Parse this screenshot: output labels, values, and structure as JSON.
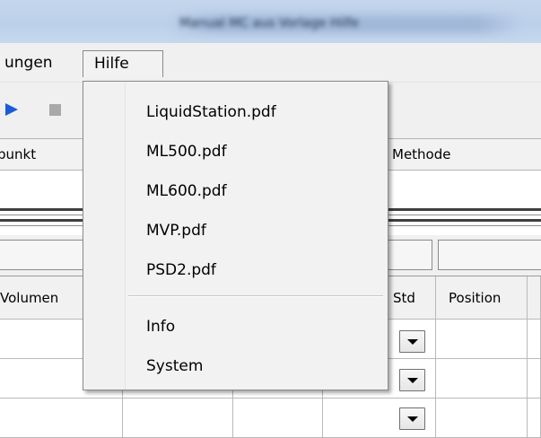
{
  "window": {
    "title": "Manual MC aus Vorlage Hilfe"
  },
  "menubar": {
    "items": [
      {
        "label": "ungen"
      },
      {
        "label": "Hilfe"
      }
    ]
  },
  "toolbar": {
    "play_icon": "play-icon",
    "stop_icon": "stop-icon",
    "accent_color": "#1a5bd8"
  },
  "header_row": {
    "col_left": "punkt",
    "col_methode": "Methode"
  },
  "grid": {
    "columns": [
      "Volumen",
      "",
      "",
      "Std",
      "Position",
      ""
    ],
    "rows": 3
  },
  "help_menu": {
    "items": [
      {
        "label": "LiquidStation.pdf"
      },
      {
        "label": "ML500.pdf"
      },
      {
        "label": "ML600.pdf"
      },
      {
        "label": "MVP.pdf"
      },
      {
        "label": "PSD2.pdf"
      },
      {
        "label": "Info"
      },
      {
        "label": "System"
      }
    ]
  }
}
